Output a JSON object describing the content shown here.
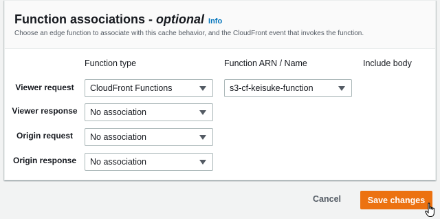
{
  "section": {
    "title": "Function associations",
    "title_dash": " - ",
    "title_optional": "optional",
    "info_link": "Info",
    "description": "Choose an edge function to associate with this cache behavior, and the CloudFront event that invokes the function."
  },
  "columns": {
    "function_type": "Function type",
    "function_arn": "Function ARN / Name",
    "include_body": "Include body"
  },
  "rows": [
    {
      "label": "Viewer request",
      "function_type": "CloudFront Functions",
      "function_arn": "s3-cf-keisuke-function"
    },
    {
      "label": "Viewer response",
      "function_type": "No association"
    },
    {
      "label": "Origin request",
      "function_type": "No association"
    },
    {
      "label": "Origin response",
      "function_type": "No association"
    }
  ],
  "actions": {
    "cancel": "Cancel",
    "save": "Save changes"
  },
  "colors": {
    "primary_button": "#ec7211",
    "link": "#0073bb"
  },
  "icons": [
    "caret-down-icon",
    "hand-pointer-cursor-icon"
  ]
}
